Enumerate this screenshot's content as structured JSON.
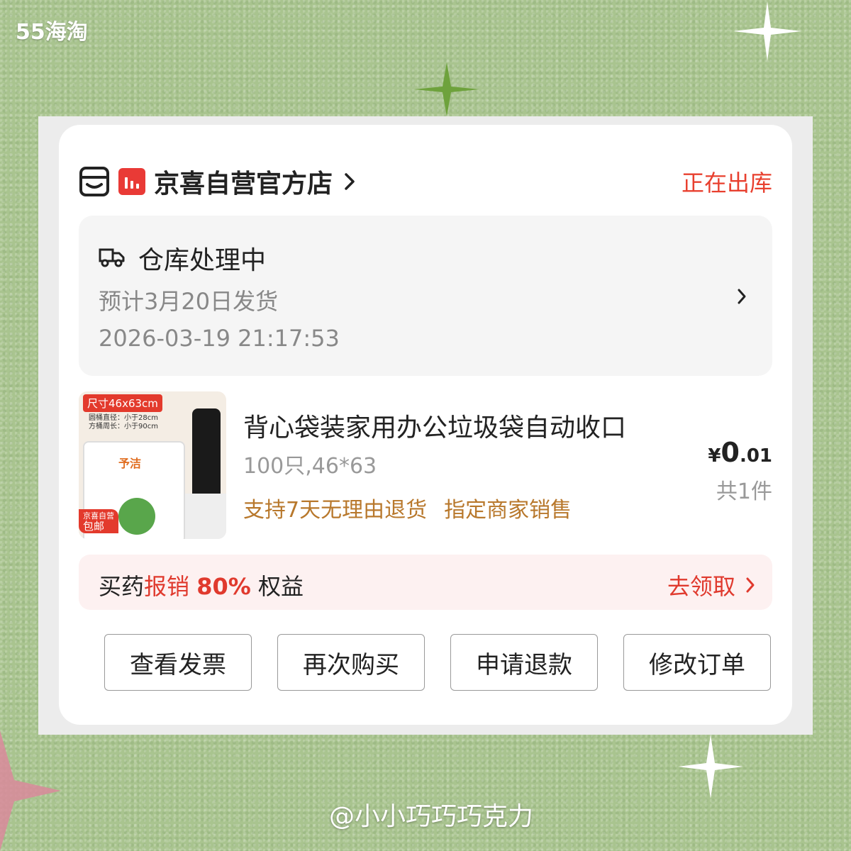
{
  "watermark": "55海淘",
  "credit": "@小小巧巧巧克力",
  "order": {
    "shop_name": "京喜自营官方店",
    "status": "正在出库",
    "logistics": {
      "title": "仓库处理中",
      "subtitle": "预计3月20日发货",
      "timestamp": "2026-03-19 21:17:53"
    },
    "product": {
      "title": "背心袋装家用办公垃圾袋自动收口",
      "spec": "100只,46*63",
      "tags": [
        "支持7天无理由退货",
        "指定商家销售"
      ],
      "price_currency": "¥",
      "price_int": "0",
      "price_dec": ".01",
      "quantity": "共1件",
      "thumb": {
        "size_tag": "尺寸46x63cm",
        "spec_line1": "圆桶直径：小于28cm",
        "spec_line2": "方桶周长：小于90cm",
        "brand": "予洁",
        "promo_line1": "京喜自营",
        "promo_line2": "包邮"
      }
    },
    "benefit": {
      "prefix": "买药",
      "highlight": "报销",
      "percent": "80%",
      "suffix": "权益",
      "action": "去领取"
    },
    "actions": [
      "查看发票",
      "再次购买",
      "申请退款",
      "修改订单"
    ]
  },
  "colors": {
    "accent_red": "#e8402f",
    "tag_brown": "#b8782c",
    "background_green": "#a9c48f"
  },
  "icons": [
    "store-icon",
    "jingxi-badge-icon",
    "chevron-right-icon",
    "truck-icon",
    "sparkle-icon"
  ]
}
